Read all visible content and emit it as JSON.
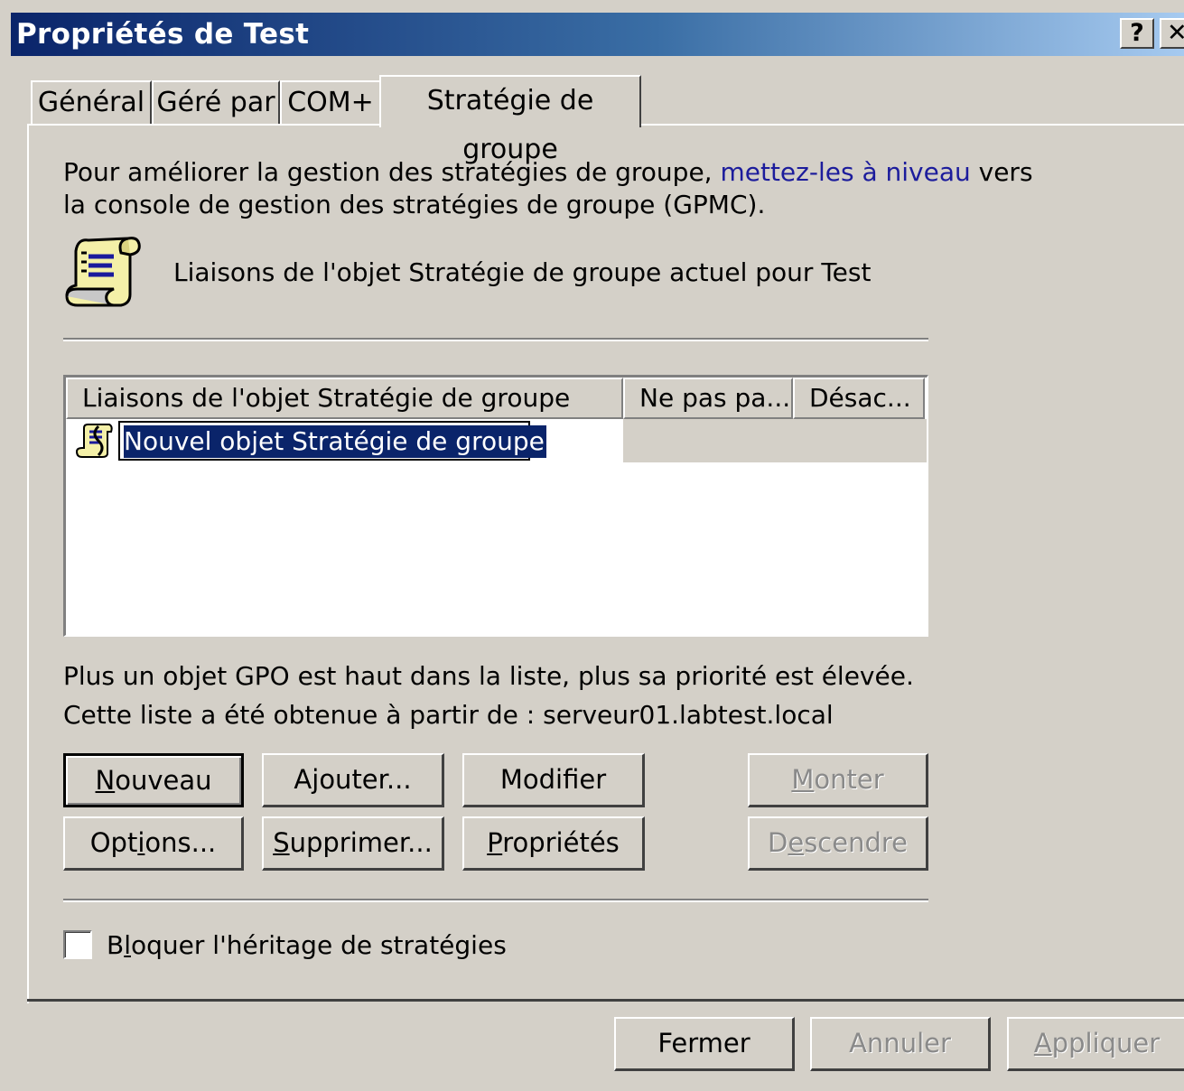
{
  "window": {
    "title": "Propriétés de Test",
    "help_label": "?",
    "close_label": "✕"
  },
  "tabs": [
    {
      "label": "Général"
    },
    {
      "label": "Géré par"
    },
    {
      "label": "COM+"
    },
    {
      "label": "Stratégie de groupe",
      "active": true
    }
  ],
  "intro": {
    "text_before": "Pour améliorer la gestion des stratégies de groupe, ",
    "link": "mettez-les à niveau",
    "text_after": " vers",
    "line2": "la console de gestion des stratégies de groupe (GPMC)."
  },
  "header_label": "Liaisons de l'objet Stratégie de groupe actuel pour Test",
  "list": {
    "columns": [
      "Liaisons de l'objet Stratégie de groupe",
      "Ne pas pa...",
      "Désac..."
    ],
    "rows": [
      {
        "name": "Nouvel objet Stratégie de groupe",
        "no_override": "",
        "disabled": ""
      }
    ]
  },
  "priority_note": "Plus un objet GPO est haut dans la liste, plus sa priorité est élevée.",
  "source_note": "Cette liste a été obtenue à partir de : serveur01.labtest.local",
  "buttons": {
    "new": {
      "pre": "",
      "key": "N",
      "post": "ouveau"
    },
    "add": {
      "pre": "Ajouter...",
      "key": "",
      "post": ""
    },
    "edit": {
      "pre": "Modif",
      "key": "i",
      "post": "er"
    },
    "up": {
      "pre": "",
      "key": "M",
      "post": "onter"
    },
    "options": {
      "pre": "Opt",
      "key": "i",
      "post": "ons..."
    },
    "delete": {
      "pre": "",
      "key": "S",
      "post": "upprimer..."
    },
    "properties": {
      "pre": "",
      "key": "P",
      "post": "ropriétés"
    },
    "down": {
      "pre": "D",
      "key": "e",
      "post": "scendre"
    }
  },
  "block_inheritance": {
    "pre": "B",
    "key": "l",
    "post": "oquer l'héritage de stratégies",
    "checked": false
  },
  "footer": {
    "close": "Fermer",
    "cancel": "Annuler",
    "apply_key": "A",
    "apply_rest": "ppliquer"
  }
}
